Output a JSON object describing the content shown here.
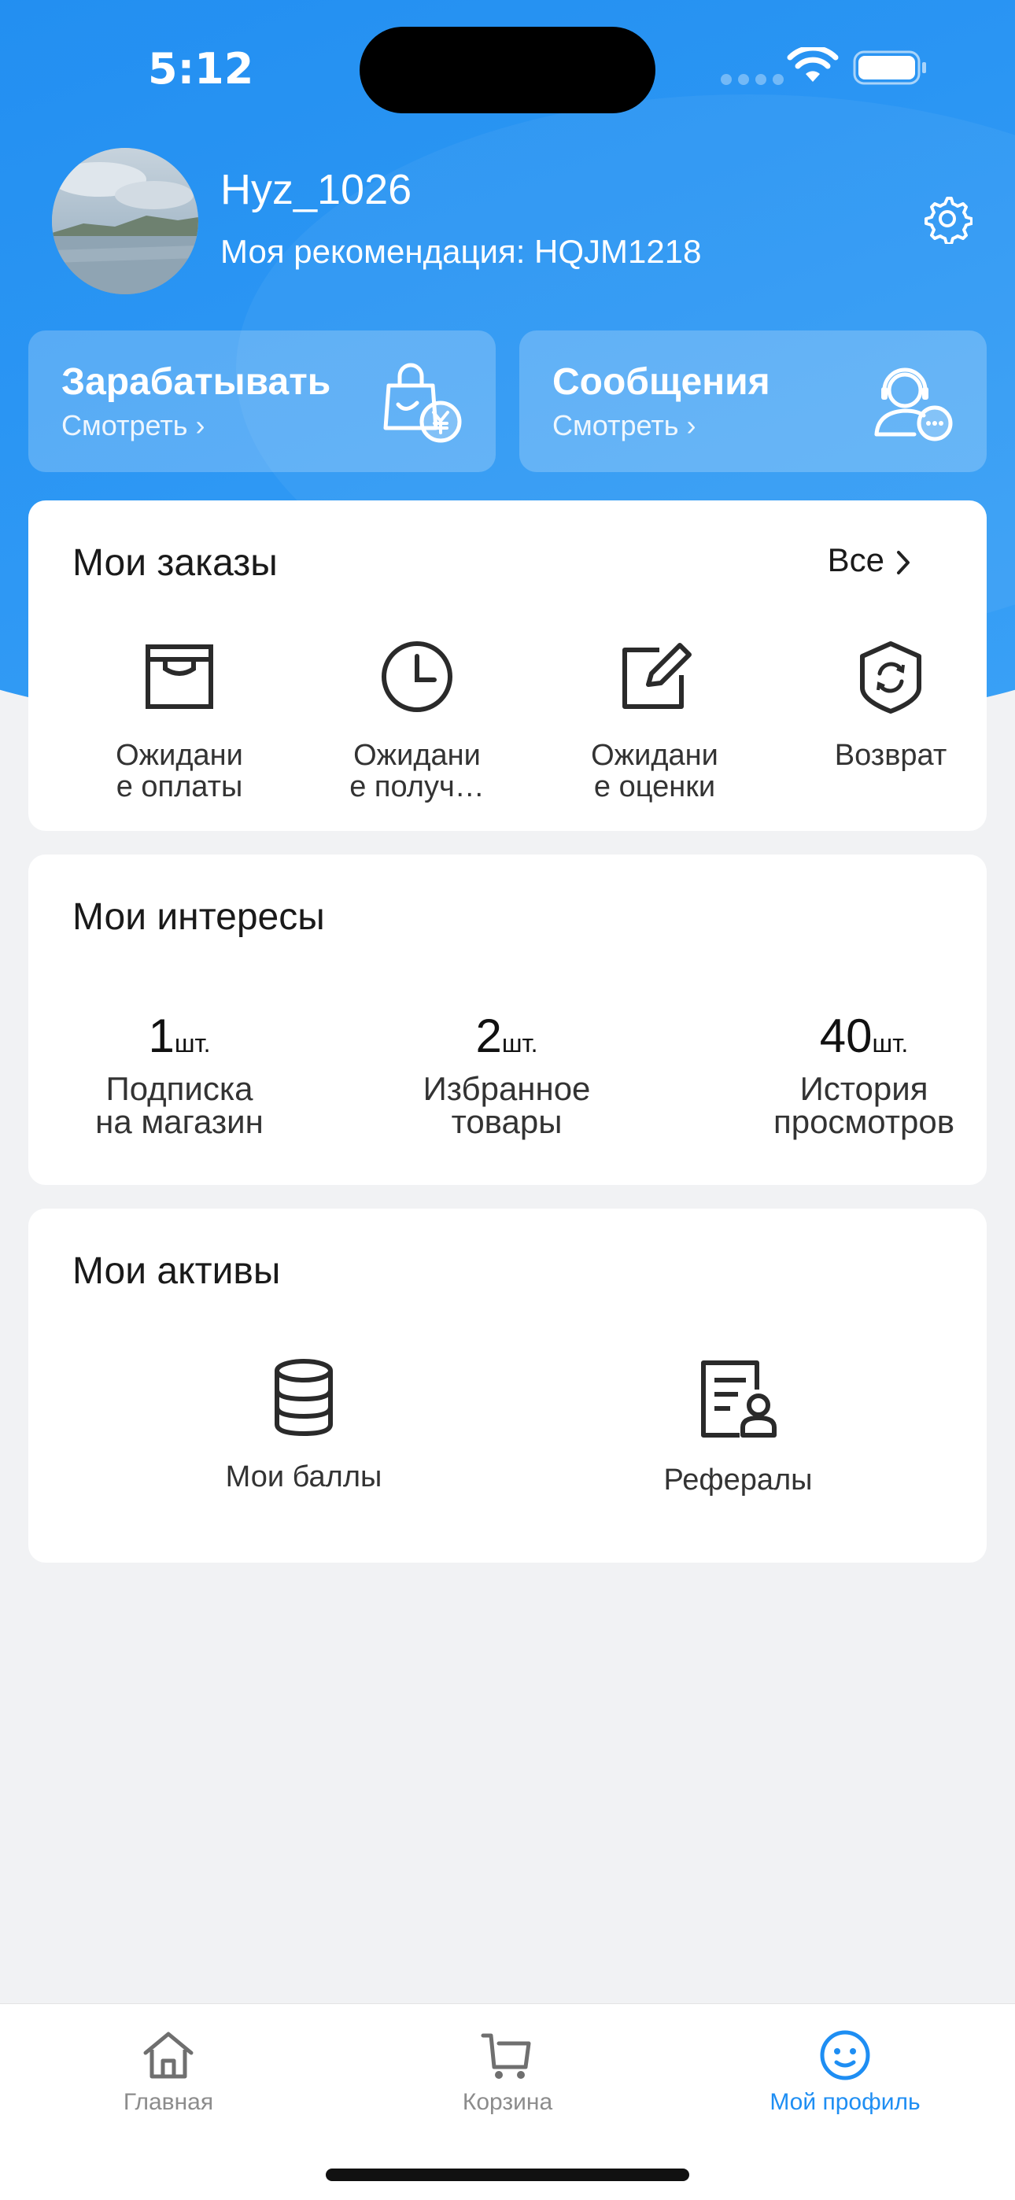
{
  "status_bar": {
    "time": "5:12"
  },
  "profile": {
    "username": "Hyz_1026",
    "referral": "Моя рекомендация: HQJM1218"
  },
  "quick_cards": [
    {
      "title": "Зарабатывать",
      "subtitle": "Смотреть ›"
    },
    {
      "title": "Сообщения",
      "subtitle": "Смотреть ›"
    }
  ],
  "orders": {
    "title": "Мои заказы",
    "see_all": "Все",
    "items": [
      {
        "label_line1": "Ожидани",
        "label_line2": "е оплаты",
        "icon": "box-icon"
      },
      {
        "label_line1": "Ожидани",
        "label_line2": "е получ…",
        "icon": "clock-icon"
      },
      {
        "label_line1": "Ожидани",
        "label_line2": "е оценки",
        "icon": "edit-icon"
      },
      {
        "label_line1": "Возврат",
        "label_line2": "",
        "icon": "refund-shield-icon"
      }
    ]
  },
  "interests": {
    "title": "Мои интересы",
    "items": [
      {
        "count": "1",
        "unit": "шт.",
        "line1": "Подписка",
        "line2": "на магазин"
      },
      {
        "count": "2",
        "unit": "шт.",
        "line1": "Избранное",
        "line2": "товары"
      },
      {
        "count": "40",
        "unit": "шт.",
        "line1": "История",
        "line2": "просмотров"
      }
    ]
  },
  "assets": {
    "title": "Мои активы",
    "items": [
      {
        "label": "Мои баллы",
        "icon": "database-icon"
      },
      {
        "label": "Рефералы",
        "icon": "referral-doc-icon"
      }
    ]
  },
  "tabbar": {
    "items": [
      {
        "label": "Главная",
        "icon": "home-icon",
        "active": false
      },
      {
        "label": "Корзина",
        "icon": "cart-icon",
        "active": false
      },
      {
        "label": "Мой профиль",
        "icon": "smile-icon",
        "active": true
      }
    ]
  },
  "colors": {
    "accent": "#1e8ef3",
    "background": "#f1f2f4",
    "header_blue": "#2a95f3"
  }
}
